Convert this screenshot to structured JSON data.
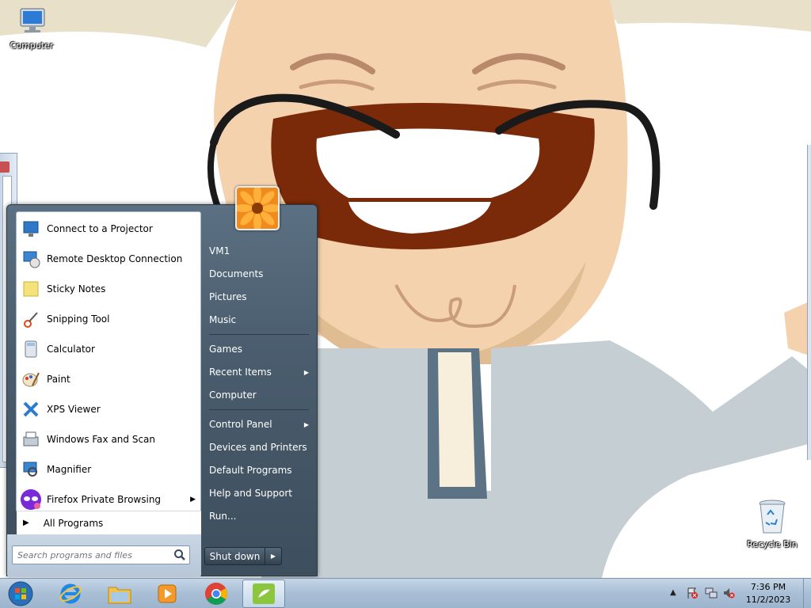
{
  "desktop": {
    "icons": [
      {
        "label": "Computer"
      },
      {
        "label": "Recycle Bin"
      }
    ]
  },
  "start_menu": {
    "programs": [
      {
        "label": "Connect to a Projector",
        "icon": "projector-icon"
      },
      {
        "label": "Remote Desktop Connection",
        "icon": "remote-desktop-icon"
      },
      {
        "label": "Sticky Notes",
        "icon": "sticky-notes-icon"
      },
      {
        "label": "Snipping Tool",
        "icon": "snipping-tool-icon"
      },
      {
        "label": "Calculator",
        "icon": "calculator-icon"
      },
      {
        "label": "Paint",
        "icon": "paint-icon"
      },
      {
        "label": "XPS Viewer",
        "icon": "xps-viewer-icon"
      },
      {
        "label": "Windows Fax and Scan",
        "icon": "fax-scan-icon"
      },
      {
        "label": "Magnifier",
        "icon": "magnifier-icon"
      },
      {
        "label": "Firefox Private Browsing",
        "icon": "firefox-private-icon"
      }
    ],
    "all_programs": "All Programs",
    "search_placeholder": "Search programs and files",
    "right_links": [
      {
        "label": "VM1"
      },
      {
        "label": "Documents"
      },
      {
        "label": "Pictures"
      },
      {
        "label": "Music"
      },
      {
        "label": "Games"
      },
      {
        "label": "Recent Items"
      },
      {
        "label": "Computer"
      },
      {
        "label": "Control Panel"
      },
      {
        "label": "Devices and Printers"
      },
      {
        "label": "Default Programs"
      },
      {
        "label": "Help and Support"
      },
      {
        "label": "Run..."
      }
    ],
    "shutdown_label": "Shut down"
  },
  "taskbar": {
    "pinned": [
      "internet-explorer-icon",
      "file-explorer-icon",
      "media-player-icon",
      "chrome-icon",
      "active-app-icon"
    ],
    "clock": {
      "time": "7:36 PM",
      "date": "11/2/2023"
    }
  },
  "colors": {
    "taskbar": "#a9bfd6",
    "start_menu_dark": "#3d4e5d",
    "link_text": "#ffffff"
  }
}
